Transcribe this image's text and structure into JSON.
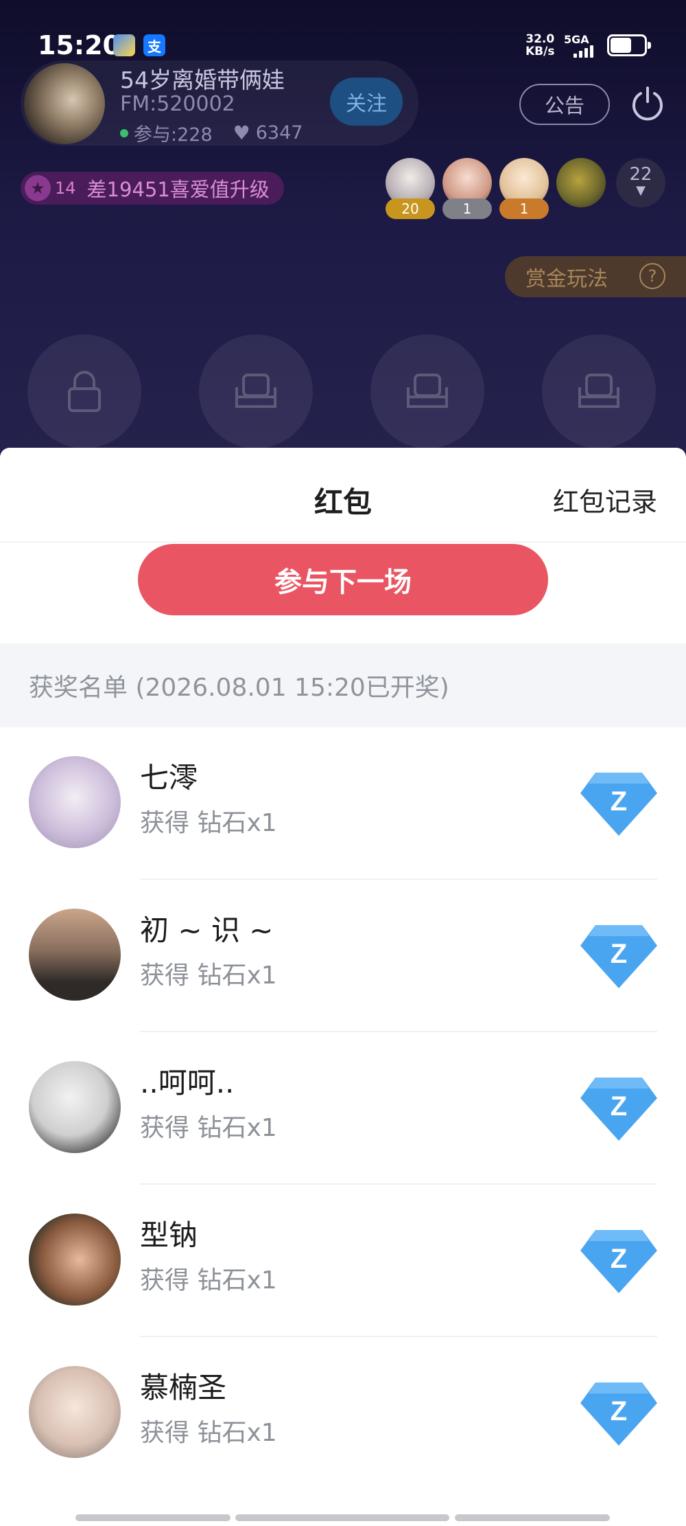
{
  "status_bar": {
    "time": "15:20",
    "net_speed_value": "32.0",
    "net_speed_unit": "KB/s",
    "signal_label": "5GA",
    "app_icons": [
      "app-icon",
      "alipay-icon"
    ],
    "alipay_glyph": "支"
  },
  "room": {
    "title": "54岁离婚带俩娃",
    "fm": "FM:520002",
    "participants": "参与:228",
    "likes": "6347",
    "follow_label": "关注",
    "notice_label": "公告",
    "level_number": "14",
    "level_text": "差19451喜爱值升级",
    "fans": [
      {
        "badge": "20",
        "badge_color": "#c8961e"
      },
      {
        "badge": "1",
        "badge_color": "#7f8088"
      },
      {
        "badge": "1",
        "badge_color": "#c97a2a"
      },
      {
        "badge": "",
        "badge_color": ""
      }
    ],
    "online_count": "22",
    "bounty_label": "赏金玩法",
    "bounty_help": "?"
  },
  "sheet": {
    "title": "红包",
    "record_link": "红包记录",
    "join_button": "参与下一场",
    "winners_header": "获奖名单 (2026.08.01 15:20已开奖)",
    "winners": [
      {
        "name": "七澪",
        "prize": "获得 钻石x1"
      },
      {
        "name": "初 ~ 识 ~",
        "prize": "获得 钻石x1"
      },
      {
        "name": "..呵呵..",
        "prize": "获得 钻石x1"
      },
      {
        "name": "型钠",
        "prize": "获得 钻石x1"
      },
      {
        "name": "慕楠圣",
        "prize": "获得 钻石x1"
      }
    ],
    "gem_letter": "Z"
  },
  "colors": {
    "accent_red": "#ea5563",
    "gem_blue": "#4aa5f0",
    "header_bg": "#1d1a45"
  }
}
